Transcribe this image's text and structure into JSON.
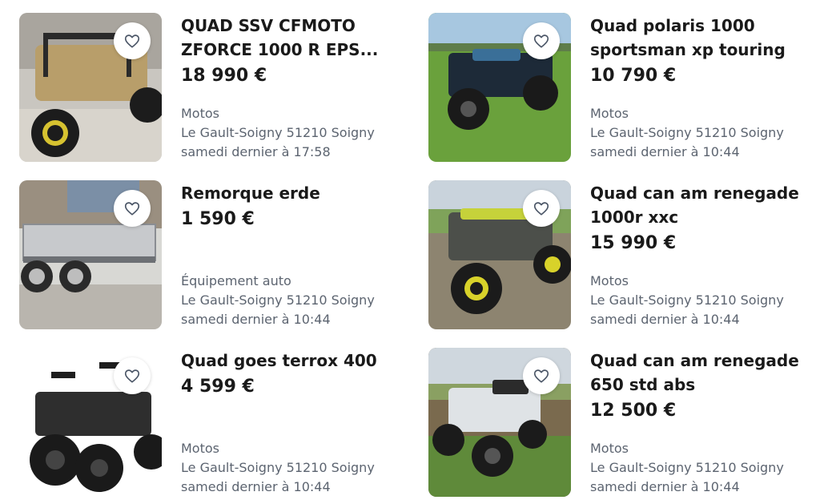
{
  "listings": [
    {
      "title": "QUAD SSV CFMOTO ZFORCE 1000 R EPS...",
      "price": "18 990 €",
      "category": "Motos",
      "location": "Le Gault-Soigny 51210 Soigny",
      "date": "samedi dernier à 17:58",
      "image": "utv-side-by-side"
    },
    {
      "title": "Quad polaris 1000 sportsman xp touring",
      "price": "10 790 €",
      "category": "Motos",
      "location": "Le Gault-Soigny 51210 Soigny",
      "date": "samedi dernier à 10:44",
      "image": "quad-blue-grass"
    },
    {
      "title": "Remorque erde",
      "price": "1 590 €",
      "category": "Équipement auto",
      "location": "Le Gault-Soigny 51210 Soigny",
      "date": "samedi dernier à 10:44",
      "image": "trailer"
    },
    {
      "title": "Quad can am renegade 1000r xxc",
      "price": "15 990 €",
      "category": "Motos",
      "location": "Le Gault-Soigny 51210 Soigny",
      "date": "samedi dernier à 10:44",
      "image": "quad-camo-field"
    },
    {
      "title": "Quad goes terrox 400",
      "price": "4 599 €",
      "category": "Motos",
      "location": "Le Gault-Soigny 51210 Soigny",
      "date": "samedi dernier à 10:44",
      "image": "quad-black-studio"
    },
    {
      "title": "Quad can am renegade 650 std abs",
      "price": "12 500 €",
      "category": "Motos",
      "location": "Le Gault-Soigny 51210 Soigny",
      "date": "samedi dernier à 10:44",
      "image": "quad-white-field"
    }
  ],
  "icons": {
    "favorite": "heart-outline-icon"
  },
  "colors": {
    "text": "#1a1a1a",
    "meta": "#5c6470",
    "heart": "#4a5566"
  }
}
